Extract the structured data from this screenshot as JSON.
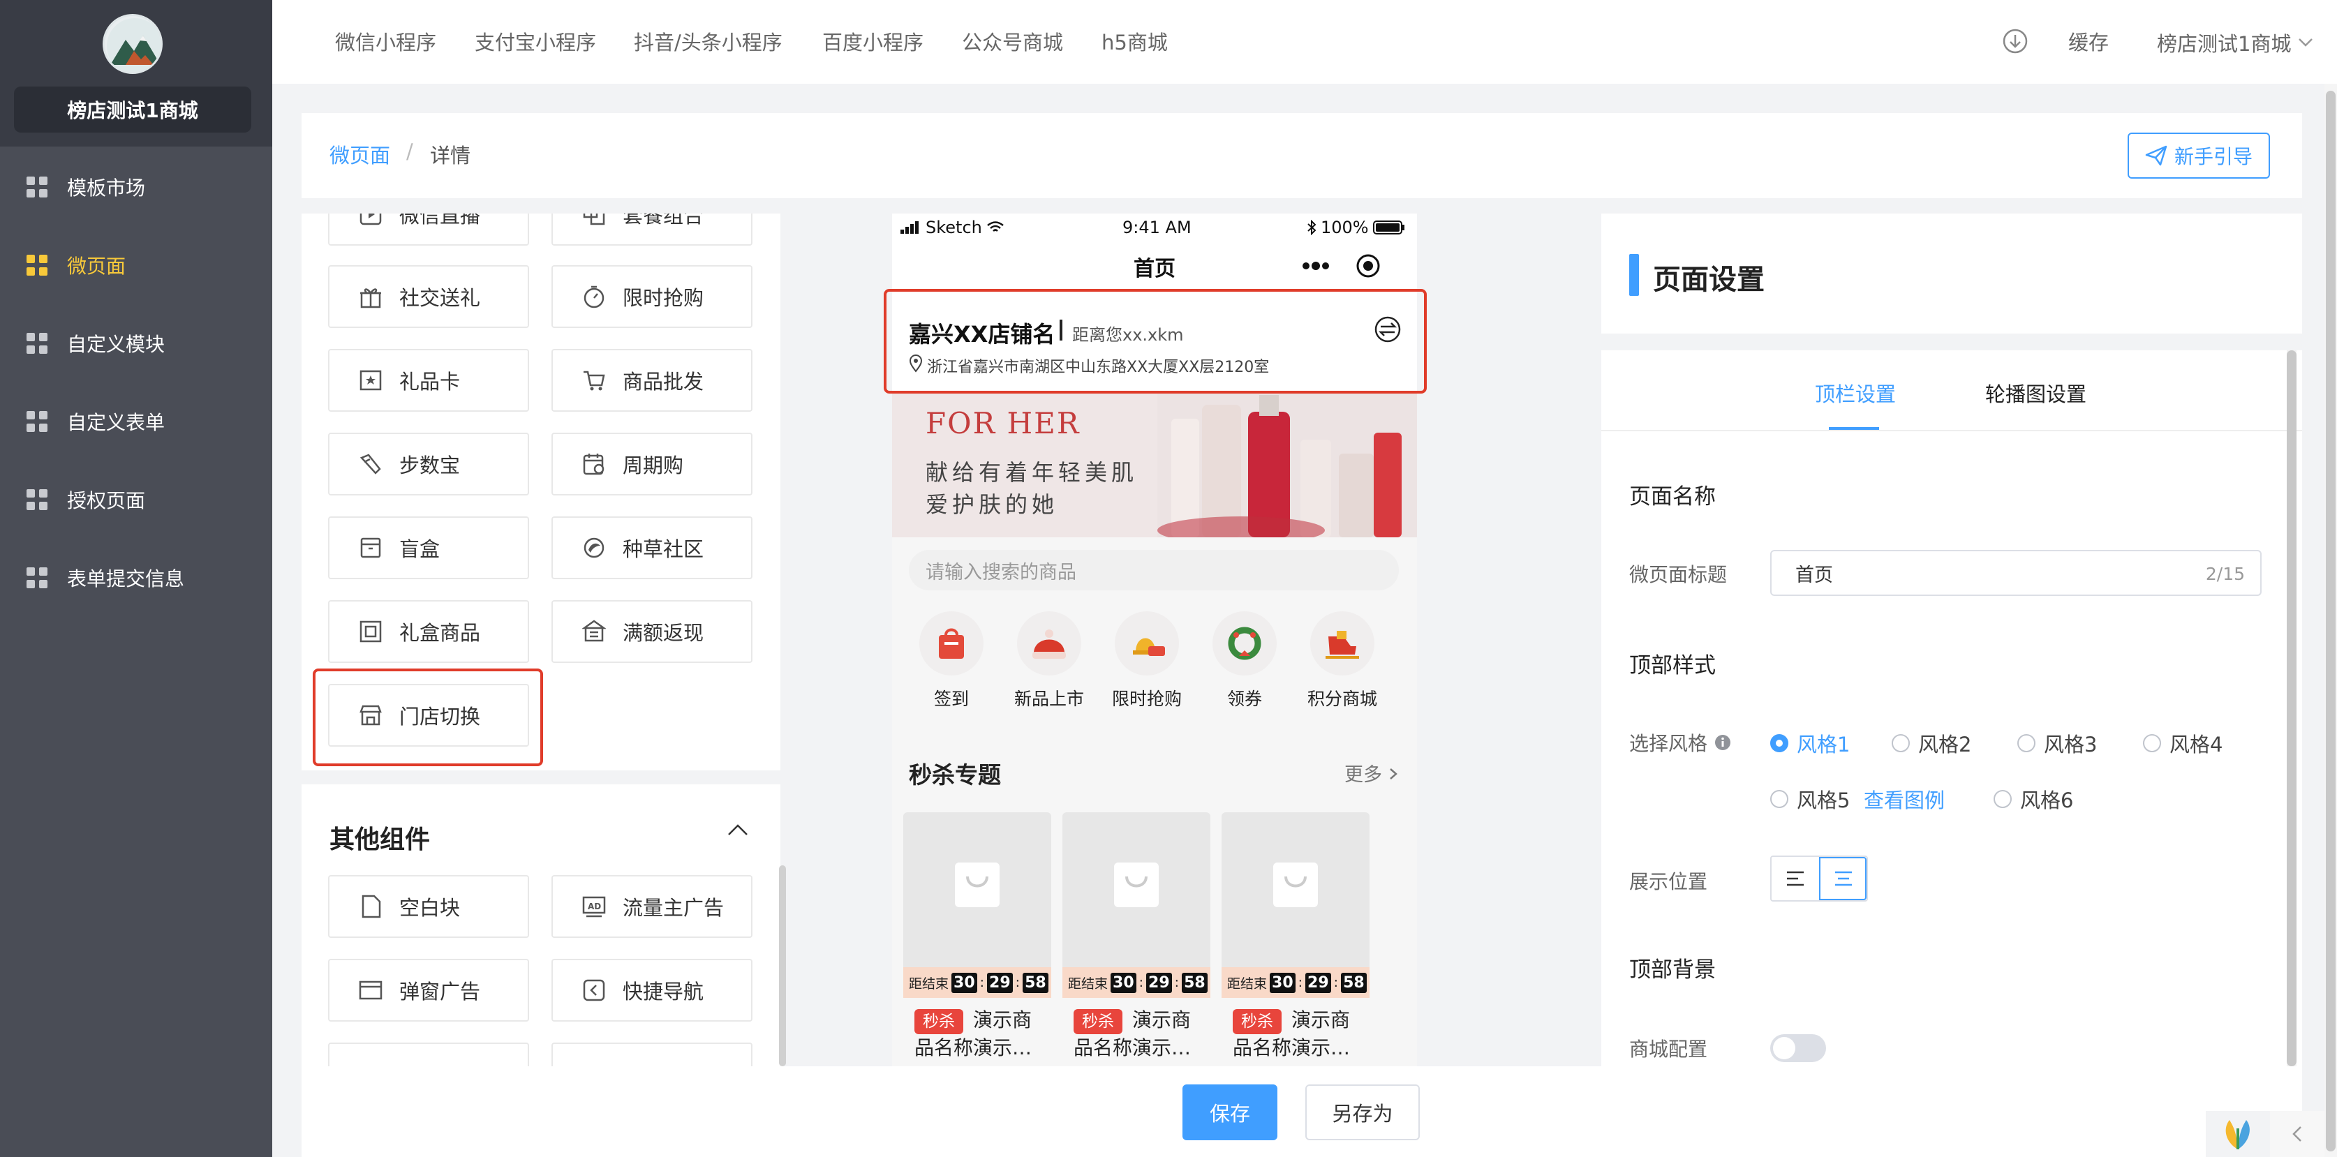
{
  "sidebar": {
    "shop_name": "榜店测试1商城",
    "items": [
      {
        "label": "模板市场"
      },
      {
        "label": "微页面",
        "active": true
      },
      {
        "label": "自定义模块"
      },
      {
        "label": "自定义表单"
      },
      {
        "label": "授权页面"
      },
      {
        "label": "表单提交信息"
      }
    ]
  },
  "topbar": {
    "tabs": [
      "微信小程序",
      "支付宝小程序",
      "抖音/头条小程序",
      "百度小程序",
      "公众号商城",
      "h5商城"
    ],
    "cache_label": "缓存",
    "shop_label": "榜店测试1商城"
  },
  "breadcrumb": {
    "home": "微页面",
    "separator": "/",
    "current": "详情"
  },
  "guide_button": "新手引导",
  "components": {
    "items": [
      "微信直播",
      "套餐组合",
      "社交送礼",
      "限时抢购",
      "礼品卡",
      "商品批发",
      "步数宝",
      "周期购",
      "盲盒",
      "种草社区",
      "礼盒商品",
      "满额返现",
      "门店切换"
    ],
    "other_title": "其他组件",
    "other_items": [
      "空白块",
      "流量主广告",
      "弹窗广告",
      "快捷导航"
    ]
  },
  "phone": {
    "status": {
      "carrier": "Sketch",
      "time": "9:41 AM",
      "battery": "100%"
    },
    "page_title": "首页",
    "store": {
      "name": "嘉兴XX店铺名",
      "distance": "距离您xx.xkm",
      "address": "浙江省嘉兴市南湖区中山东路XX大厦XX层2120室"
    },
    "banner": {
      "en": "FOR HER",
      "line1": "献给有着年轻美肌",
      "line2": "爱护肤的她"
    },
    "search_placeholder": "请输入搜索的商品",
    "categories": [
      "签到",
      "新品上市",
      "限时抢购",
      "领券",
      "积分商城"
    ],
    "flash": {
      "title": "秒杀专题",
      "more": "更多"
    },
    "products": [
      {
        "tag": "秒杀",
        "name1": "演示商",
        "name2": "品名称演示…",
        "countdown_label": "距结束",
        "h": "30",
        "m": "29",
        "s": "58"
      },
      {
        "tag": "秒杀",
        "name1": "演示商",
        "name2": "品名称演示…",
        "countdown_label": "距结束",
        "h": "30",
        "m": "29",
        "s": "58"
      },
      {
        "tag": "秒杀",
        "name1": "演示商",
        "name2": "品名称演示…",
        "countdown_label": "距结束",
        "h": "30",
        "m": "29",
        "s": "58"
      }
    ]
  },
  "settings": {
    "title": "页面设置",
    "tabs": [
      "顶栏设置",
      "轮播图设置"
    ],
    "page_name_section": "页面名称",
    "title_label": "微页面标题",
    "title_value": "首页",
    "title_count": "2/15",
    "top_style_section": "顶部样式",
    "style_label": "选择风格",
    "styles": [
      "风格1",
      "风格2",
      "风格3",
      "风格4",
      "风格5",
      "风格6"
    ],
    "selected_style": "风格1",
    "view_example": "查看图例",
    "position_label": "展示位置",
    "top_bg_section": "顶部背景",
    "mall_config_label": "商城配置",
    "mall_config_on": false
  },
  "footer": {
    "save": "保存",
    "save_as": "另存为"
  },
  "colors": {
    "accent": "#409eff",
    "highlight": "#e03c2a",
    "sidebar": "#4a4d56",
    "active_nav": "#f8c93a"
  }
}
